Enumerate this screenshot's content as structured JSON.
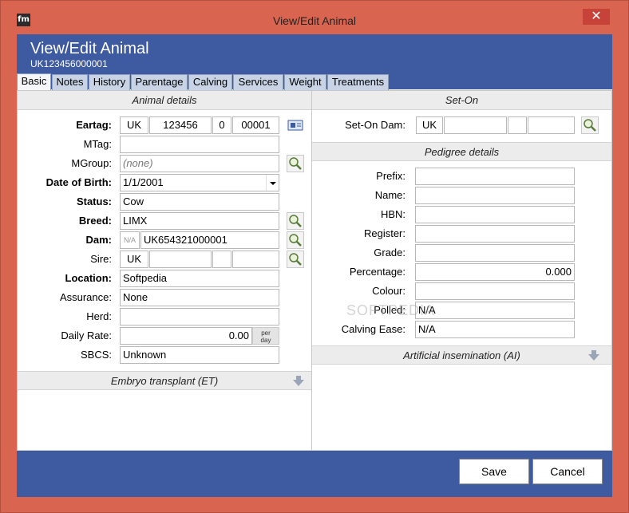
{
  "window": {
    "title": "View/Edit Animal",
    "app_icon_text": "fm",
    "close_symbol": "✕"
  },
  "header": {
    "title": "View/Edit Animal",
    "subtitle": "UK123456000001"
  },
  "tabs": [
    "Basic",
    "Notes",
    "History",
    "Parentage",
    "Calving",
    "Services",
    "Weight",
    "Treatments"
  ],
  "left": {
    "section_title": "Animal details",
    "eartag": {
      "label": "Eartag:",
      "country": "UK",
      "herd": "123456",
      "check": "0",
      "number": "00001"
    },
    "mtag": {
      "label": "MTag:",
      "value": ""
    },
    "mgroup": {
      "label": "MGroup:",
      "value": "(none)"
    },
    "dob": {
      "label": "Date of Birth:",
      "value": "1/1/2001"
    },
    "status": {
      "label": "Status:",
      "value": "Cow"
    },
    "breed": {
      "label": "Breed:",
      "value": "LIMX"
    },
    "dam": {
      "label": "Dam:",
      "prefix": "N/A",
      "value": "UK654321000001"
    },
    "sire": {
      "label": "Sire:",
      "country": "UK",
      "herd": "",
      "check": "",
      "number": ""
    },
    "location": {
      "label": "Location:",
      "value": "Softpedia"
    },
    "assurance": {
      "label": "Assurance:",
      "value": "None"
    },
    "herd": {
      "label": "Herd:",
      "value": ""
    },
    "daily_rate": {
      "label": "Daily Rate:",
      "value": "0.00",
      "unit_line1": "per",
      "unit_line2": "day"
    },
    "sbcs": {
      "label": "SBCS:",
      "value": "Unknown"
    },
    "et_section_title": "Embryo transplant (ET)"
  },
  "right": {
    "seton_title": "Set-On",
    "seton_dam": {
      "label": "Set-On Dam:",
      "country": "UK",
      "herd": "",
      "check": "",
      "number": ""
    },
    "pedigree_title": "Pedigree details",
    "pedigree": [
      {
        "label": "Prefix:",
        "value": ""
      },
      {
        "label": "Name:",
        "value": ""
      },
      {
        "label": "HBN:",
        "value": ""
      },
      {
        "label": "Register:",
        "value": ""
      },
      {
        "label": "Grade:",
        "value": ""
      },
      {
        "label": "Percentage:",
        "value": "0.000"
      },
      {
        "label": "Colour:",
        "value": ""
      },
      {
        "label": "Polled:",
        "value": "N/A"
      },
      {
        "label": "Calving Ease:",
        "value": "N/A"
      }
    ],
    "ai_title": "Artificial insemination (AI)"
  },
  "footer": {
    "save_label": "Save",
    "cancel_label": "Cancel"
  },
  "watermark": "SOFTPEDIA",
  "colors": {
    "frame": "#d9644f",
    "header_blue": "#3e5aa0",
    "close_red": "#c7433a"
  }
}
